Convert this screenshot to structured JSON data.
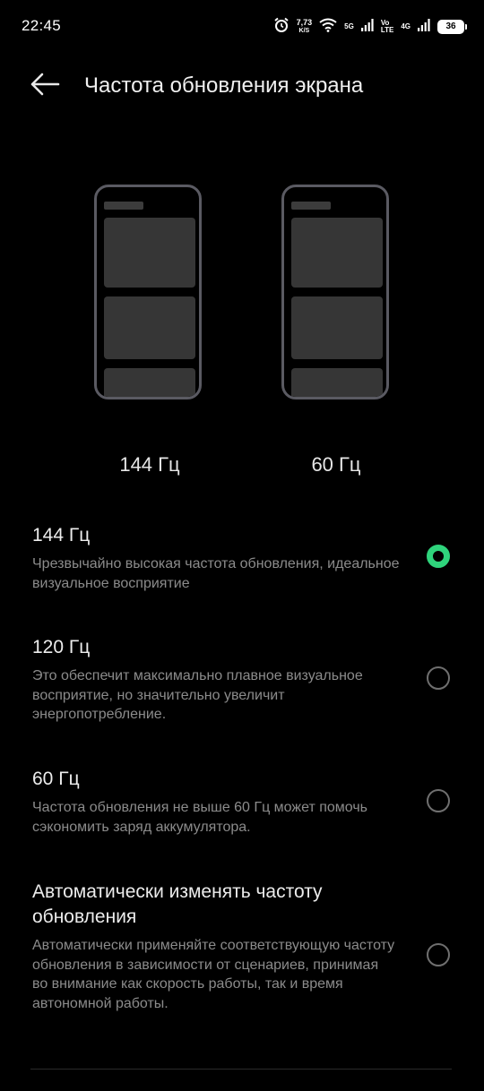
{
  "status_bar": {
    "time": "22:45",
    "speed_value": "7,73",
    "speed_unit": "K/S",
    "net1": "5G",
    "volte_top": "Vo",
    "volte_bottom": "LTE",
    "net2": "4G",
    "battery": "36",
    "icons": [
      "alarm-icon",
      "wifi-icon",
      "signal-icon",
      "signal-icon",
      "battery-icon"
    ]
  },
  "header": {
    "back_icon": "back-arrow-icon",
    "title": "Частота обновления экрана"
  },
  "preview": {
    "left_label": "144 Гц",
    "right_label": "60 Гц"
  },
  "options": [
    {
      "title": "144 Гц",
      "description": "Чрезвычайно высокая частота обновления, идеальное визуальное восприятие",
      "selected": true
    },
    {
      "title": "120 Гц",
      "description": "Это обеспечит максимально плавное визуальное восприятие, но значительно увеличит энергопотребление.",
      "selected": false
    },
    {
      "title": "60 Гц",
      "description": "Частота обновления не выше 60 Гц может помочь сэкономить заряд аккумулятора.",
      "selected": false
    },
    {
      "title": "Автоматически изменять частоту обновления",
      "description": "Автоматически применяйте соответствующую частоту обновления в зависимости от сценариев, принимая во внимание как скорость работы, так и время автономной работы.",
      "selected": false
    }
  ],
  "colors": {
    "background": "#000000",
    "accent": "#2fd47c",
    "secondary_text": "#8b8b8b"
  }
}
